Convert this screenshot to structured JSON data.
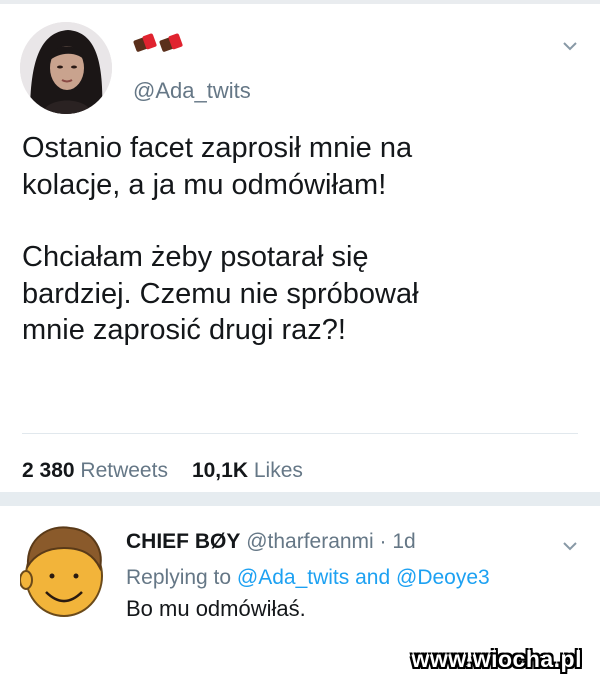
{
  "tweet": {
    "emoji": "chocolate-bar chocolate-bar",
    "handle": "@Ada_twits",
    "text_lines": [
      "Ostanio facet zaprosił mnie na",
      "kolacje, a ja mu odmówiłam!",
      "Chciałam żeby psotarał się",
      "bardziej. Czemu nie spróbował",
      "mnie zaprosić drugi raz?!"
    ],
    "retweets_count": "2 380",
    "retweets_label": "Retweets",
    "likes_count": "10,1K",
    "likes_label": "Likes"
  },
  "reply": {
    "name": "CHIEF BØY",
    "meta": "@tharferanmi · 1d",
    "replying_prefix": "Replying to",
    "mention_1": "@Ada_twits",
    "replying_and": "and",
    "mention_2": "@Deoye3",
    "text": "Bo mu odmówiłaś."
  },
  "watermark": "www.wiocha.pl",
  "colors": {
    "accent": "#1da1f2",
    "muted": "#657786",
    "text": "#14171a"
  }
}
